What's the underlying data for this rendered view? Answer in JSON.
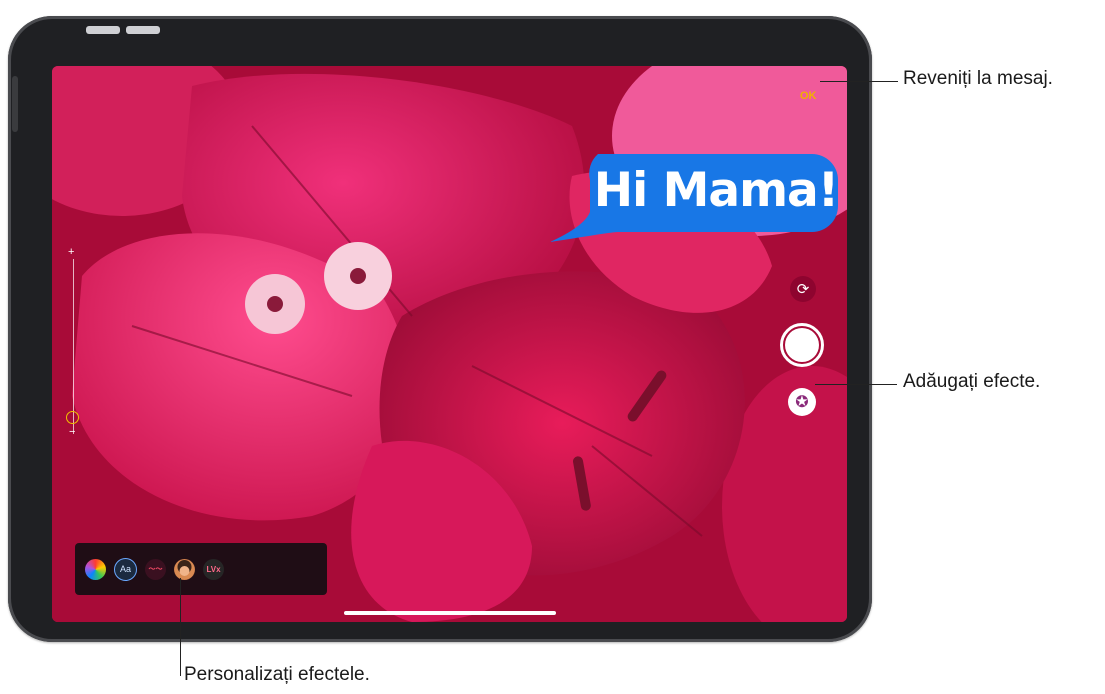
{
  "message": {
    "bubble_text": "Hi Mama!",
    "bubble_color": "#1877e6"
  },
  "camera": {
    "done_label": "OK",
    "zoom_plus": "+",
    "zoom_minus": "−",
    "zoom_level_fraction": 0.9
  },
  "effects_tray": {
    "items": [
      {
        "name": "filters-icon",
        "label": ""
      },
      {
        "name": "text-effect-icon",
        "label": "Aa"
      },
      {
        "name": "shapes-icon",
        "label": "〜〜"
      },
      {
        "name": "memoji-icon",
        "label": ""
      },
      {
        "name": "stickers-icon",
        "label": "LVx"
      }
    ]
  },
  "callouts": {
    "back_to_message": "Reveniți la mesaj.",
    "add_effects": "Adăugați efecte.",
    "customize_effects": "Personalizați efectele."
  },
  "colors": {
    "accent_yellow": "#f0b100",
    "photo_magenta": "#d0164f"
  }
}
